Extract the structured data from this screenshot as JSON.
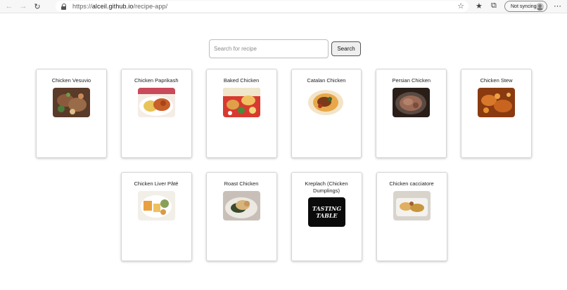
{
  "browser": {
    "url_prefix": "https://",
    "url_host": "alceil.github.io",
    "url_path": "/recipe-app/",
    "sync_label": "Not syncing"
  },
  "search": {
    "placeholder": "Search for recipe",
    "button_label": "Search"
  },
  "recipes": [
    {
      "title": "Chicken Vesuvio",
      "thumb_icon": "chicken-vesuvio-photo"
    },
    {
      "title": "Chicken Paprikash",
      "thumb_icon": "chicken-paprikash-photo"
    },
    {
      "title": "Baked Chicken",
      "thumb_icon": "baked-chicken-photo"
    },
    {
      "title": "Catalan Chicken",
      "thumb_icon": "catalan-chicken-photo"
    },
    {
      "title": "Persian Chicken",
      "thumb_icon": "persian-chicken-photo"
    },
    {
      "title": "Chicken Stew",
      "thumb_icon": "chicken-stew-photo"
    },
    {
      "title": "Chicken Liver Pâté",
      "thumb_icon": "chicken-liver-pate-photo"
    },
    {
      "title": "Roast Chicken",
      "thumb_icon": "roast-chicken-photo"
    },
    {
      "title": "Kreplach (Chicken Dumplings)",
      "thumb_icon": "kreplach-logo",
      "thumb_text": "TASTING TABLE"
    },
    {
      "title": "Chicken cacciatore",
      "thumb_icon": "chicken-cacciatore-photo"
    }
  ]
}
